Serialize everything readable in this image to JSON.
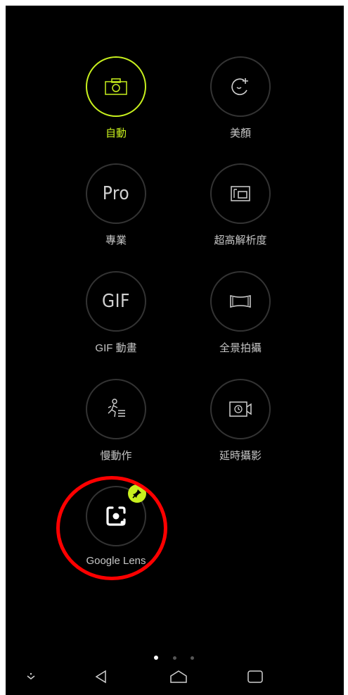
{
  "modes": [
    {
      "id": "auto",
      "label": "自動",
      "icon": "camera-icon",
      "active": true
    },
    {
      "id": "beauty",
      "label": "美顏",
      "icon": "beauty-face-icon",
      "active": false
    },
    {
      "id": "pro",
      "label": "專業",
      "icon_text": "Pro",
      "icon": "pro-text-icon",
      "active": false
    },
    {
      "id": "superres",
      "label": "超高解析度",
      "icon": "super-resolution-icon",
      "active": false
    },
    {
      "id": "gif",
      "label": "GIF 動畫",
      "icon_text": "GIF",
      "icon": "gif-text-icon",
      "active": false
    },
    {
      "id": "panorama",
      "label": "全景拍攝",
      "icon": "panorama-icon",
      "active": false
    },
    {
      "id": "slowmo",
      "label": "慢動作",
      "icon": "slow-motion-icon",
      "active": false
    },
    {
      "id": "timelapse",
      "label": "延時攝影",
      "icon": "time-lapse-icon",
      "active": false
    },
    {
      "id": "lens",
      "label": "Google Lens",
      "icon": "google-lens-icon",
      "active": false,
      "pinned": true
    }
  ],
  "pager": {
    "pages": 3,
    "current": 1
  },
  "nav": [
    "collapse-icon",
    "back-icon",
    "home-icon",
    "recents-icon"
  ],
  "colors": {
    "accent": "#c8f01e",
    "highlight": "#ff0000",
    "background": "#000000"
  }
}
